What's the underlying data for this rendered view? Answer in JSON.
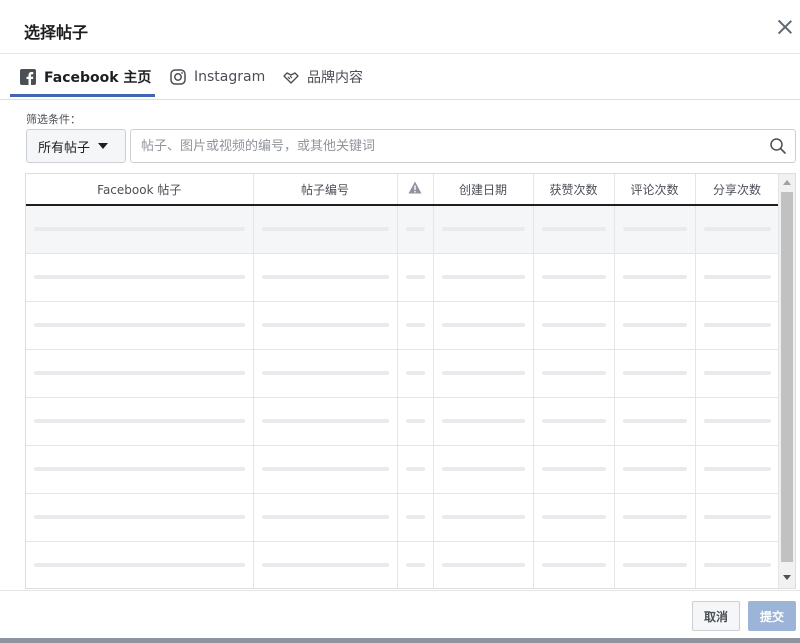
{
  "dialog": {
    "title": "选择帖子"
  },
  "tabs": [
    {
      "label": "Facebook 主页",
      "icon": "facebook-icon",
      "active": true
    },
    {
      "label": "Instagram",
      "icon": "instagram-icon",
      "active": false
    },
    {
      "label": "品牌内容",
      "icon": "handshake-icon",
      "active": false
    }
  ],
  "filter": {
    "label": "筛选条件：",
    "dropdown_value": "所有帖子",
    "search_placeholder": "帖子、图片或视频的编号，或其他关键词"
  },
  "table": {
    "columns": [
      "Facebook 帖子",
      "帖子编号",
      "",
      "创建日期",
      "获赞次数",
      "评论次数",
      "分享次数"
    ],
    "row_count": 8
  },
  "footer": {
    "cancel_label": "取消",
    "submit_label": "提交"
  },
  "colors": {
    "accent": "#4267b2",
    "submit_disabled": "#9cb4d8",
    "skeleton": "#e9eaed"
  }
}
